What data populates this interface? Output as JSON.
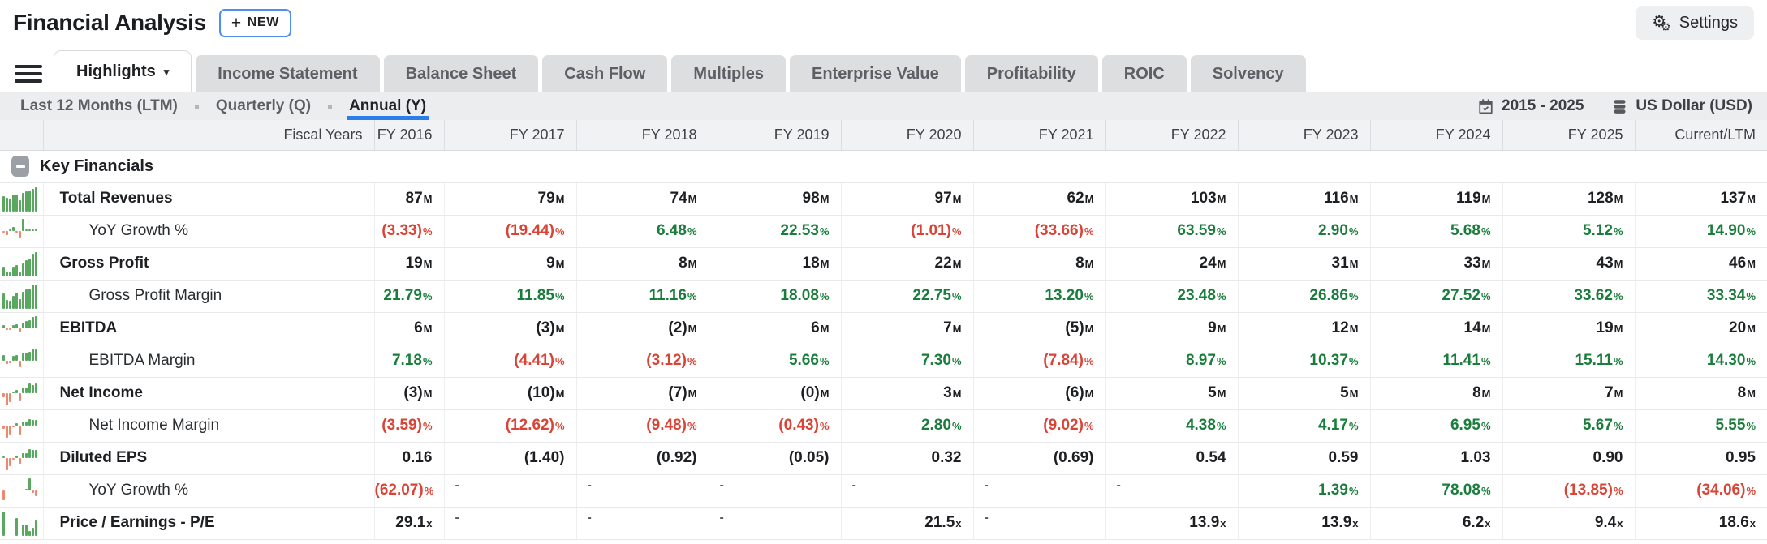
{
  "app": {
    "title": "Financial Analysis",
    "new_label": "NEW",
    "settings_label": "Settings"
  },
  "icons": {
    "plus": "+",
    "caret": "▾",
    "gear": "⚙"
  },
  "tabs": {
    "active": "Highlights",
    "items": [
      "Highlights",
      "Income Statement",
      "Balance Sheet",
      "Cash Flow",
      "Multiples",
      "Enterprise Value",
      "Profitability",
      "ROIC",
      "Solvency"
    ]
  },
  "periods": {
    "active": "Annual (Y)",
    "items": [
      "Last 12 Months (LTM)",
      "Quarterly (Q)",
      "Annual (Y)"
    ]
  },
  "filters": {
    "date_range": "2015 - 2025",
    "currency": "US Dollar (USD)"
  },
  "section": {
    "title": "Key Financials"
  },
  "table": {
    "corner_label": "Fiscal Years",
    "columns": [
      "FY 2016",
      "FY 2017",
      "FY 2018",
      "FY 2019",
      "FY 2020",
      "FY 2021",
      "FY 2022",
      "FY 2023",
      "FY 2024",
      "FY 2025",
      "Current/LTM"
    ],
    "rows": [
      {
        "label": "Total Revenues",
        "indent": false,
        "type": "money",
        "values": [
          "87M",
          "79M",
          "74M",
          "98M",
          "97M",
          "62M",
          "103M",
          "116M",
          "119M",
          "128M",
          "137M"
        ]
      },
      {
        "label": "YoY Growth %",
        "indent": true,
        "type": "pct",
        "values": [
          "(3.33)%",
          "(19.44)%",
          "6.48%",
          "22.53%",
          "(1.01)%",
          "(33.66)%",
          "63.59%",
          "2.90%",
          "5.68%",
          "5.12%",
          "14.90%"
        ]
      },
      {
        "label": "Gross Profit",
        "indent": false,
        "type": "money",
        "values": [
          "19M",
          "9M",
          "8M",
          "18M",
          "22M",
          "8M",
          "24M",
          "31M",
          "33M",
          "43M",
          "46M"
        ]
      },
      {
        "label": "Gross Profit Margin",
        "indent": true,
        "type": "pct",
        "values": [
          "21.79%",
          "11.85%",
          "11.16%",
          "18.08%",
          "22.75%",
          "13.20%",
          "23.48%",
          "26.86%",
          "27.52%",
          "33.62%",
          "33.34%"
        ]
      },
      {
        "label": "EBITDA",
        "indent": false,
        "type": "money",
        "values": [
          "6M",
          "(3)M",
          "(2)M",
          "6M",
          "7M",
          "(5)M",
          "9M",
          "12M",
          "14M",
          "19M",
          "20M"
        ]
      },
      {
        "label": "EBITDA Margin",
        "indent": true,
        "type": "pct",
        "values": [
          "7.18%",
          "(4.41)%",
          "(3.12)%",
          "5.66%",
          "7.30%",
          "(7.84)%",
          "8.97%",
          "10.37%",
          "11.41%",
          "15.11%",
          "14.30%"
        ]
      },
      {
        "label": "Net Income",
        "indent": false,
        "type": "money",
        "values": [
          "(3)M",
          "(10)M",
          "(7)M",
          "(0)M",
          "3M",
          "(6)M",
          "5M",
          "5M",
          "8M",
          "7M",
          "8M"
        ]
      },
      {
        "label": "Net Income Margin",
        "indent": true,
        "type": "pct",
        "values": [
          "(3.59)%",
          "(12.62)%",
          "(9.48)%",
          "(0.43)%",
          "2.80%",
          "(9.02)%",
          "4.38%",
          "4.17%",
          "6.95%",
          "5.67%",
          "5.55%"
        ]
      },
      {
        "label": "Diluted EPS",
        "indent": false,
        "type": "eps",
        "values": [
          "0.16",
          "(1.40)",
          "(0.92)",
          "(0.05)",
          "0.32",
          "(0.69)",
          "0.54",
          "0.59",
          "1.03",
          "0.90",
          "0.95"
        ]
      },
      {
        "label": "YoY Growth %",
        "indent": true,
        "type": "pct",
        "values": [
          "(62.07)%",
          "-",
          "-",
          "-",
          "-",
          "-",
          "-",
          "1.39%",
          "78.08%",
          "(13.85)%",
          "(34.06)%"
        ]
      },
      {
        "label": "Price / Earnings - P/E",
        "indent": false,
        "type": "mult",
        "values": [
          "29.1x",
          "-",
          "-",
          "-",
          "21.5x",
          "-",
          "13.9x",
          "13.9x",
          "6.2x",
          "9.4x",
          "18.6x"
        ]
      }
    ]
  },
  "colors": {
    "green": "#1a7d3c",
    "red": "#da4437",
    "accent_blue": "#2b7de9",
    "bar_green": "#5aa860",
    "bar_red": "#ec8a70"
  }
}
